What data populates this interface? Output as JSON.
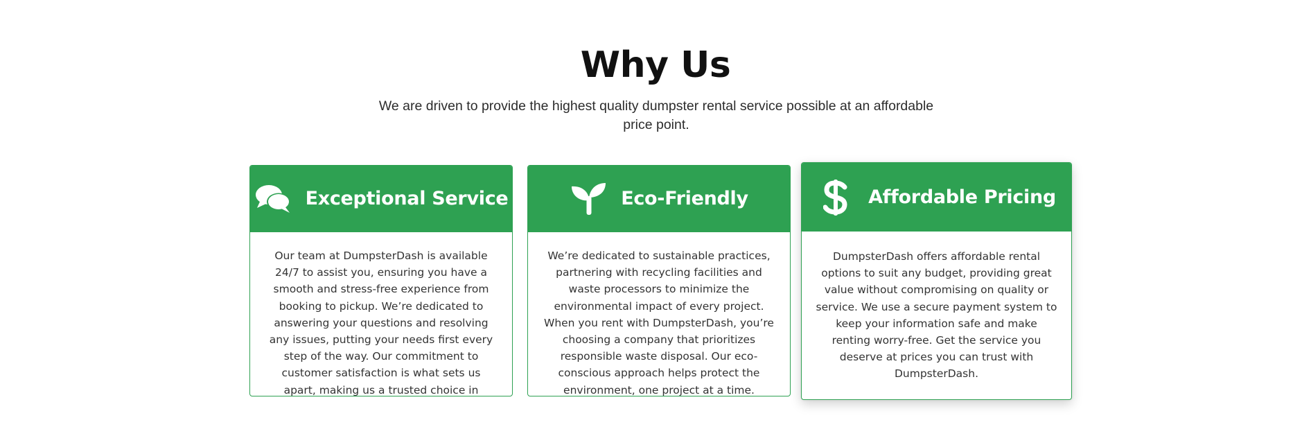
{
  "section": {
    "title": "Why Us",
    "subtitle": "We are driven to provide the highest quality dumpster rental service possible at an affordable price point."
  },
  "cards": [
    {
      "icon": "chat-bubbles-icon",
      "title": "Exceptional Service",
      "body": "Our team at DumpsterDash is available 24/7 to assist you, ensuring you have a smooth and stress-free experience from booking to pickup. We’re dedicated to answering your questions and resolving any issues, putting your needs first every step of the way. Our commitment to customer satisfaction is what sets us apart, making us a trusted choice in dumpster rentals."
    },
    {
      "icon": "seedling-icon",
      "title": "Eco-Friendly",
      "body": "We’re dedicated to sustainable practices, partnering with recycling facilities and waste processors to minimize the environmental impact of every project. When you rent with DumpsterDash, you’re choosing a company that prioritizes responsible waste disposal. Our eco-conscious approach helps protect the environment, one project at a time."
    },
    {
      "icon": "dollar-sign-icon",
      "title": "Affordable Pricing",
      "body": "DumpsterDash offers affordable rental options to suit any budget, providing great value without compromising on quality or service. We use a secure payment system to keep your information safe and make renting worry-free. Get the service you deserve at prices you can trust with DumpsterDash."
    }
  ],
  "colors": {
    "accent_green": "#2ea152",
    "heading": "#111111",
    "body_text": "#333333"
  }
}
